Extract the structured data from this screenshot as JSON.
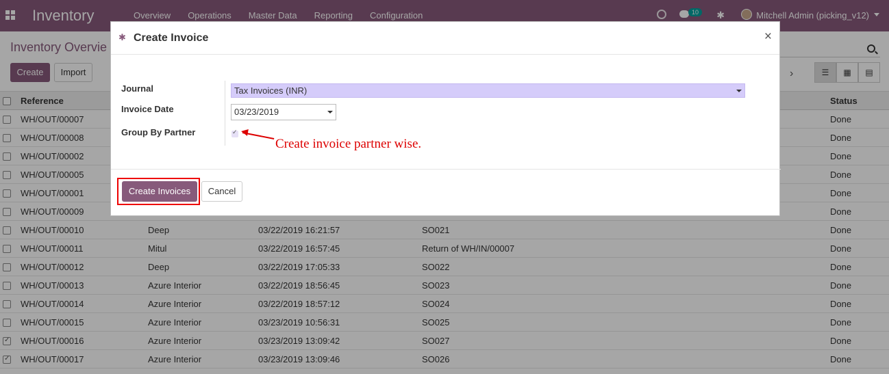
{
  "navbar": {
    "app_title": "Inventory",
    "menu": [
      "Overview",
      "Operations",
      "Master Data",
      "Reporting",
      "Configuration"
    ],
    "chat_count": "10",
    "user": "Mitchell Admin (picking_v12)"
  },
  "control_panel": {
    "breadcrumb": "Inventory Overvie",
    "create_label": "Create",
    "import_label": "Import"
  },
  "list": {
    "headers": [
      "Reference",
      "Status"
    ],
    "rows": [
      {
        "ref": "WH/OUT/00007",
        "partner": "",
        "date": "",
        "source": "",
        "status": "Done",
        "checked": false
      },
      {
        "ref": "WH/OUT/00008",
        "partner": "",
        "date": "",
        "source": "",
        "status": "Done",
        "checked": false
      },
      {
        "ref": "WH/OUT/00002",
        "partner": "",
        "date": "",
        "source": "",
        "status": "Done",
        "checked": false
      },
      {
        "ref": "WH/OUT/00005",
        "partner": "",
        "date": "",
        "source": "",
        "status": "Done",
        "checked": false
      },
      {
        "ref": "WH/OUT/00001",
        "partner": "",
        "date": "",
        "source": "",
        "status": "Done",
        "checked": false
      },
      {
        "ref": "WH/OUT/00009",
        "partner": "",
        "date": "",
        "source": "",
        "status": "Done",
        "checked": false
      },
      {
        "ref": "WH/OUT/00010",
        "partner": "Deep",
        "date": "03/22/2019 16:21:57",
        "source": "SO021",
        "status": "Done",
        "checked": false
      },
      {
        "ref": "WH/OUT/00011",
        "partner": "Mitul",
        "date": "03/22/2019 16:57:45",
        "source": "Return of WH/IN/00007",
        "status": "Done",
        "checked": false
      },
      {
        "ref": "WH/OUT/00012",
        "partner": "Deep",
        "date": "03/22/2019 17:05:33",
        "source": "SO022",
        "status": "Done",
        "checked": false
      },
      {
        "ref": "WH/OUT/00013",
        "partner": "Azure Interior",
        "date": "03/22/2019 18:56:45",
        "source": "SO023",
        "status": "Done",
        "checked": false
      },
      {
        "ref": "WH/OUT/00014",
        "partner": "Azure Interior",
        "date": "03/22/2019 18:57:12",
        "source": "SO024",
        "status": "Done",
        "checked": false
      },
      {
        "ref": "WH/OUT/00015",
        "partner": "Azure Interior",
        "date": "03/23/2019 10:56:31",
        "source": "SO025",
        "status": "Done",
        "checked": false
      },
      {
        "ref": "WH/OUT/00016",
        "partner": "Azure Interior",
        "date": "03/23/2019 13:09:42",
        "source": "SO027",
        "status": "Done",
        "checked": true
      },
      {
        "ref": "WH/OUT/00017",
        "partner": "Azure Interior",
        "date": "03/23/2019 13:09:46",
        "source": "SO026",
        "status": "Done",
        "checked": true
      }
    ]
  },
  "modal": {
    "title": "Create Invoice",
    "close": "×",
    "journal_label": "Journal",
    "journal_value": "Tax Invoices (INR)",
    "invoice_date_label": "Invoice Date",
    "invoice_date_value": "03/23/2019",
    "group_label": "Group By Partner",
    "annotation": "Create invoice partner wise.",
    "create_button": "Create Invoices",
    "cancel_button": "Cancel"
  }
}
